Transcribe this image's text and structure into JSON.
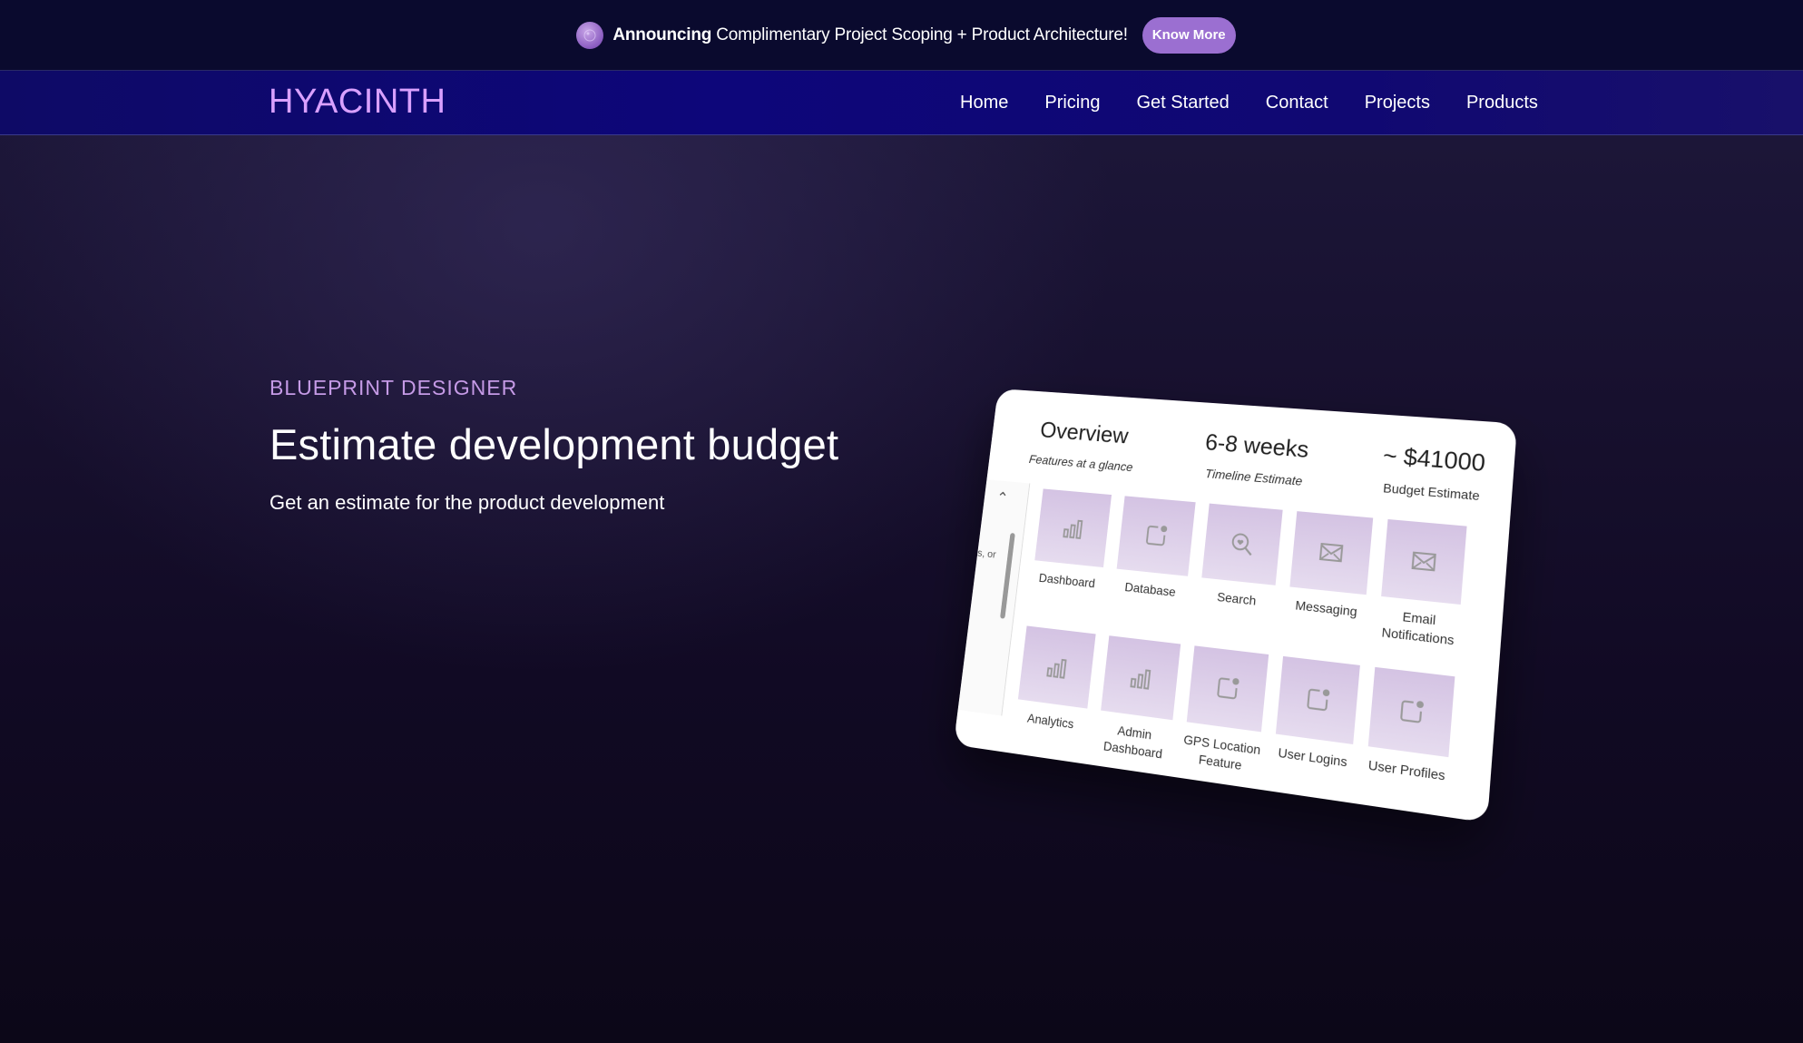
{
  "announcement": {
    "bold": "Announcing",
    "text": "Complimentary Project Scoping + Product Architecture!",
    "button_label": "Know More",
    "icon": "moon-globe-icon"
  },
  "nav": {
    "logo": "HYACINTH",
    "links": [
      {
        "label": "Home"
      },
      {
        "label": "Pricing"
      },
      {
        "label": "Get Started"
      },
      {
        "label": "Contact"
      },
      {
        "label": "Projects"
      },
      {
        "label": "Products"
      }
    ]
  },
  "hero": {
    "eyebrow": "BLUEPRINT DESIGNER",
    "headline": "Estimate development budget",
    "subline": "Get an estimate for the product development"
  },
  "preview": {
    "stats": [
      {
        "value": "Overview",
        "label": "Features at a glance"
      },
      {
        "value": "6-8 weeks",
        "label": "Timeline Estimate"
      },
      {
        "value": "~ $41000",
        "label": "Budget Estimate"
      }
    ],
    "side_text": "s, or",
    "features_row1": [
      {
        "label": "Dashboard",
        "icon": "bar-chart-icon"
      },
      {
        "label": "Database",
        "icon": "notification-square-icon"
      },
      {
        "label": "Search",
        "icon": "search-heart-icon"
      },
      {
        "label": "Messaging",
        "icon": "envelope-icon"
      },
      {
        "label": "Email Notifications",
        "icon": "envelope-icon"
      }
    ],
    "features_row2": [
      {
        "label": "Analytics",
        "icon": "bar-chart-icon"
      },
      {
        "label": "Admin Dashboard",
        "icon": "bar-chart-icon"
      },
      {
        "label": "GPS Location Feature",
        "icon": "notification-square-icon"
      },
      {
        "label": "User Logins",
        "icon": "notification-square-icon"
      },
      {
        "label": "User Profiles",
        "icon": "notification-square-icon"
      }
    ]
  }
}
